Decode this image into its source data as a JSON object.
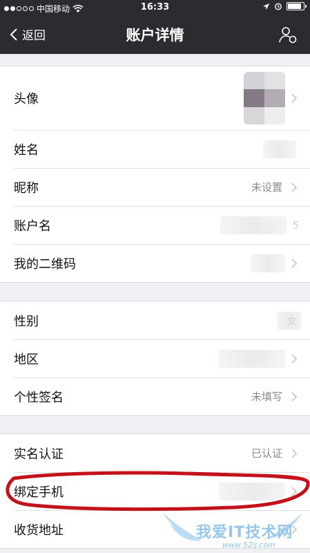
{
  "status_bar": {
    "carrier": "中国移动",
    "time": "16:33"
  },
  "nav": {
    "back_label": "返回",
    "title": "账户详情",
    "right_icon": "profile-switch-icon"
  },
  "groups": [
    {
      "rows": [
        {
          "label": "头像",
          "value": "",
          "type": "avatar"
        },
        {
          "label": "姓名",
          "value": "",
          "type": "hidden"
        },
        {
          "label": "昵称",
          "value": "未设置",
          "type": "text"
        },
        {
          "label": "账户名",
          "value": "5",
          "type": "hidden"
        },
        {
          "label": "我的二维码",
          "value": "",
          "type": "hidden"
        }
      ]
    },
    {
      "rows": [
        {
          "label": "性别",
          "value": "女",
          "type": "hidden"
        },
        {
          "label": "地区",
          "value": "",
          "type": "hidden"
        },
        {
          "label": "个性签名",
          "value": "未填写",
          "type": "text"
        }
      ]
    },
    {
      "rows": [
        {
          "label": "实名认证",
          "value": "已认证",
          "type": "text"
        },
        {
          "label": "绑定手机",
          "value": "",
          "type": "hidden"
        },
        {
          "label": "收货地址",
          "value": "",
          "type": "text"
        }
      ]
    }
  ],
  "watermark": {
    "text": "我爱IT技术网",
    "url": "www.52ij.com"
  },
  "colors": {
    "nav_bg": "#2b2b30",
    "page_bg": "#efeff4",
    "annotation_red": "#c4121c",
    "watermark_blue": "#8fc2e8"
  }
}
